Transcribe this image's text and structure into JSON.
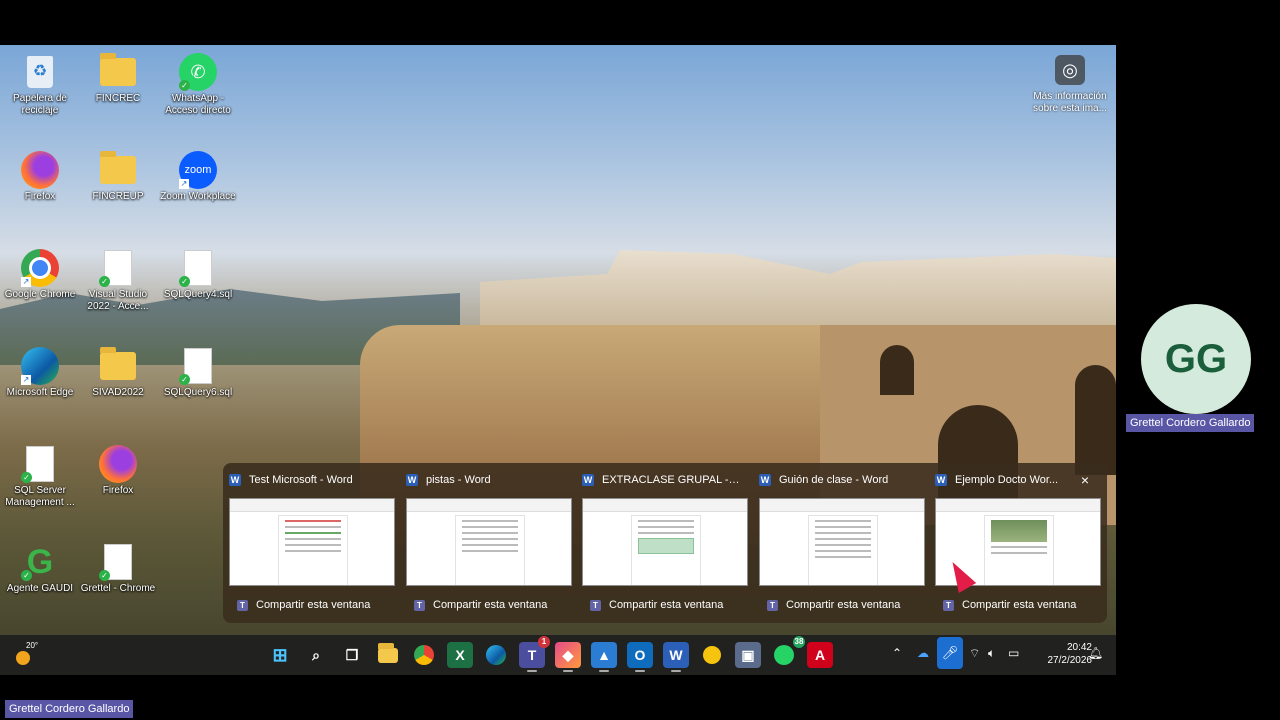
{
  "desktop": {
    "icons": [
      {
        "label": "Papelera de reciclaje",
        "icon": "recycle-bin-icon"
      },
      {
        "label": "FINCREC",
        "icon": "folder-icon"
      },
      {
        "label": "WhatsApp - Acceso directo",
        "icon": "whatsapp-icon"
      },
      {
        "label": "Firefox",
        "icon": "firefox-icon"
      },
      {
        "label": "FINCREUP",
        "icon": "folder-icon"
      },
      {
        "label": "Zoom Workplace",
        "icon": "zoom-icon",
        "text": "zoom"
      },
      {
        "label": "Google Chrome",
        "icon": "chrome-icon"
      },
      {
        "label": "Visual Studio 2022 - Acce...",
        "icon": "file-icon"
      },
      {
        "label": "SQLQuery4.sql",
        "icon": "file-icon"
      },
      {
        "label": "Microsoft Edge",
        "icon": "edge-icon"
      },
      {
        "label": "SIVAD2022",
        "icon": "folder-icon"
      },
      {
        "label": "SQLQuery6.sql",
        "icon": "file-icon"
      },
      {
        "label": "SQL Server Management ...",
        "icon": "file-icon"
      },
      {
        "label": "Firefox",
        "icon": "firefox-icon"
      },
      {
        "label": "Agente GAUDI",
        "icon": "gaudi-icon",
        "text": "G"
      },
      {
        "label": "Grettel - Chrome",
        "icon": "file-icon"
      }
    ],
    "info_button": {
      "label": "Más información sobre esta ima...",
      "icon": "camera-icon"
    }
  },
  "thumbnails": [
    {
      "title": "Test Microsoft - Word",
      "share": "Compartir esta ventana"
    },
    {
      "title": "pistas - Word",
      "share": "Compartir esta ventana"
    },
    {
      "title": "EXTRACLASE GRUPAL - W...",
      "share": "Compartir esta ventana"
    },
    {
      "title": "Guión de clase - Word",
      "share": "Compartir esta ventana"
    },
    {
      "title": "Ejemplo Docto Wor...",
      "share": "Compartir esta ventana",
      "close": "×"
    }
  ],
  "taskbar": {
    "weather_temp": "20°",
    "teams_badge": "1",
    "whatsapp_badge": "38",
    "time": "20:42",
    "date": "27/2/2026"
  },
  "participant": {
    "initials": "GG",
    "name": "Grettel Cordero Gallardo"
  },
  "self_name": "Grettel Cordero Gallardo"
}
